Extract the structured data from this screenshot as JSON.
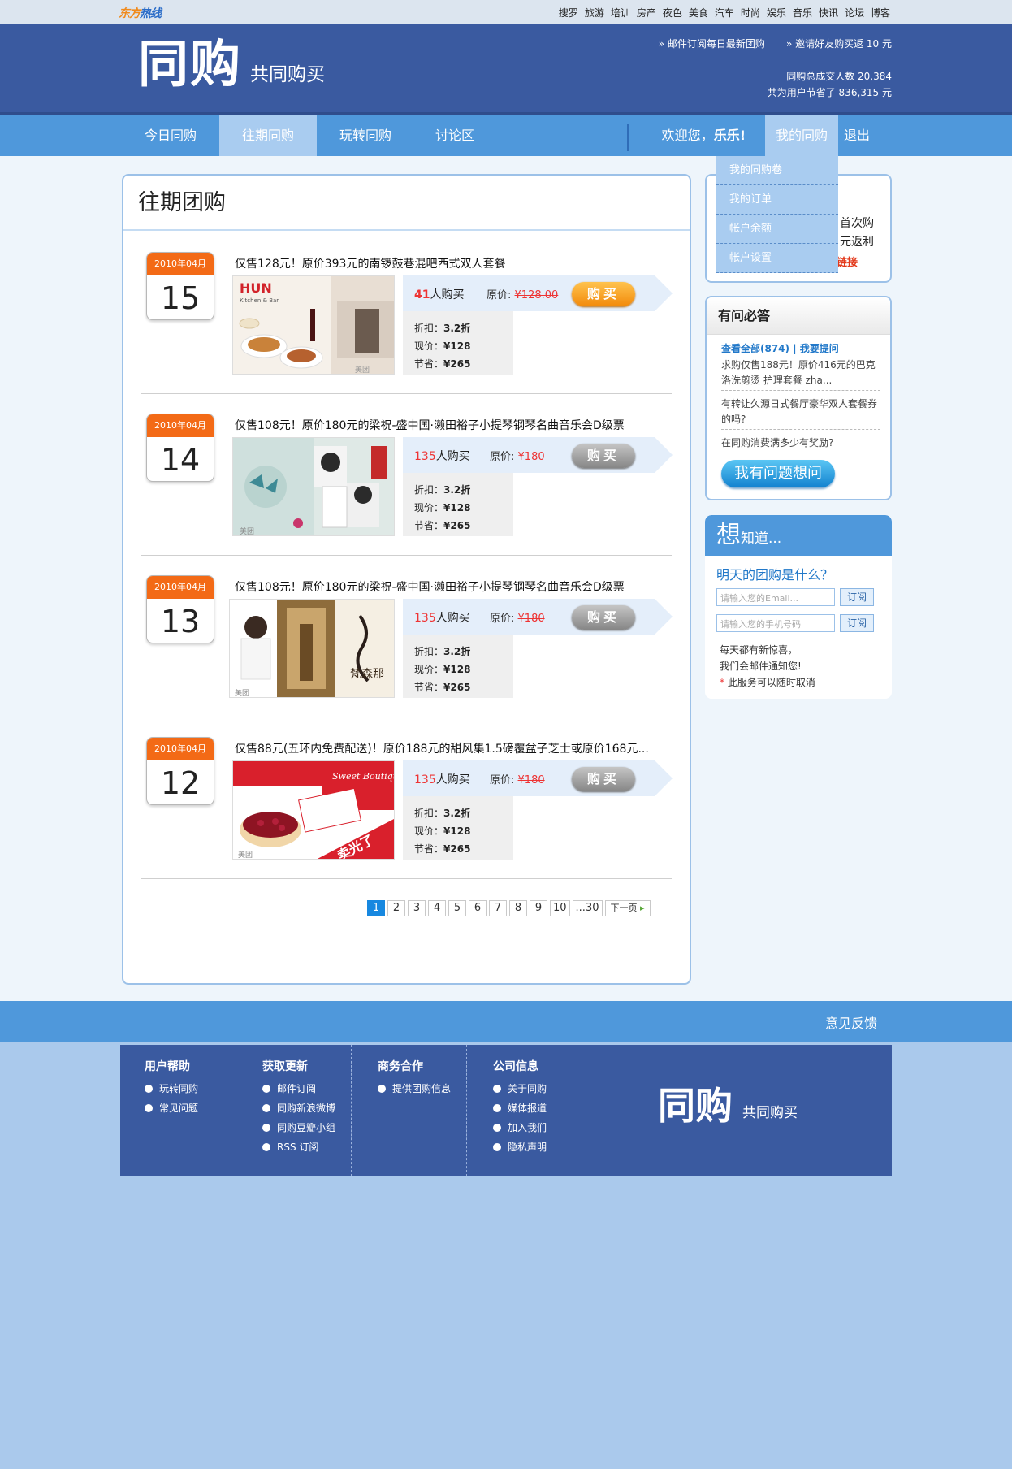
{
  "topbar": {
    "logo_a": "东方",
    "logo_b": "热线",
    "nav": [
      "搜罗",
      "旅游",
      "培训",
      "房产",
      "夜色",
      "美食",
      "汽车",
      "时尚",
      "娱乐",
      "音乐",
      "快讯",
      "论坛",
      "博客"
    ]
  },
  "header": {
    "brand_big": "同购",
    "brand_small": "共同购买",
    "link_subscribe": "» 邮件订阅每日最新团购",
    "link_invite": "» 邀请好友购买返 10 元",
    "stat_deals": "同购总成交人数 20,384",
    "stat_saved": "共为用户节省了 836,315 元"
  },
  "nav": {
    "today": "今日同购",
    "past": "往期同购",
    "play": "玩转同购",
    "forum": "讨论区",
    "welcome": "欢迎您，",
    "user": "乐乐!",
    "mine": "我的同购",
    "logout": "退出"
  },
  "dropdown": [
    "我的同购卷",
    "我的订单",
    "帐户余额",
    "帐户设置"
  ],
  "main": {
    "title": "往期团购",
    "buy_label": "购买",
    "buyers_suffix": "人购买",
    "orig_label": "原价:",
    "discount_label": "折扣：",
    "now_label": "现价：",
    "save_label": "节省：",
    "deals": [
      {
        "month": "2010年04月",
        "day": "15",
        "title": "仅售128元！原价393元的南锣鼓巷混吧西式双人套餐",
        "buyers": "41",
        "orig": "¥128.00",
        "discount": "3.2折",
        "price": "¥128",
        "save": "¥265",
        "button": "orange"
      },
      {
        "month": "2010年04月",
        "day": "14",
        "title": "仅售108元！原价180元的梁祝-盛中国·濑田裕子小提琴钢琴名曲音乐会D级票",
        "buyers": "135",
        "orig": "¥180",
        "discount": "3.2折",
        "price": "¥128",
        "save": "¥265",
        "button": "gray"
      },
      {
        "month": "2010年04月",
        "day": "13",
        "title": "仅售108元！原价180元的梁祝-盛中国·濑田裕子小提琴钢琴名曲音乐会D级票",
        "buyers": "135",
        "orig": "¥180",
        "discount": "3.2折",
        "price": "¥128",
        "save": "¥265",
        "button": "gray"
      },
      {
        "month": "2010年04月",
        "day": "12",
        "title": "仅售88元(五环内免费配送)！原价188元的甜风集1.5磅覆盆子芝士或原价168元...",
        "buyers": "135",
        "orig": "¥180",
        "discount": "3.2折",
        "price": "¥128",
        "save": "¥265",
        "button": "gray",
        "soldout": "卖光了"
      }
    ],
    "photo1_brand": "HUN",
    "photo1_sub": "Kitchen & Bar",
    "photo4_brand": "Sweet Boutique",
    "photo3_brand": "梵森那",
    "photo_watermark": "美团",
    "pager": [
      "1",
      "2",
      "3",
      "4",
      "5",
      "6",
      "7",
      "8",
      "9",
      "10",
      "...30"
    ],
    "pager_next": "下一页"
  },
  "side1": {
    "line1": "首次购",
    "line2": "元返利",
    "line3": "链接"
  },
  "faq": {
    "title": "有问必答",
    "links": "查看全部(874) | 我要提问",
    "q1": "求购仅售188元！原价416元的巴克洛洗剪烫 护理套餐 zha...",
    "q2": "有转让久源日式餐厅豪华双人套餐券的吗?",
    "q3": "在同购消费满多少有奖励?",
    "button": "我有问题想问"
  },
  "want": {
    "big": "想",
    "small": "知道...",
    "question": "明天的团购是什么？",
    "email_placeholder": "请输入您的Email...",
    "phone_placeholder": "请输入您的手机号码",
    "subscribe": "订阅",
    "note1": "每天都有新惊喜，",
    "note2": "我们会邮件通知您!",
    "note3": "此服务可以随时取消"
  },
  "footer": {
    "feedback": "意见反馈",
    "cols": [
      {
        "title": "用户帮助",
        "items": [
          "玩转同购",
          "常见问题"
        ]
      },
      {
        "title": "获取更新",
        "items": [
          "邮件订阅",
          "同购新浪微博",
          "同购豆瓣小组",
          "RSS 订阅"
        ]
      },
      {
        "title": "商务合作",
        "items": [
          "提供团购信息"
        ]
      },
      {
        "title": "公司信息",
        "items": [
          "关于同购",
          "媒体报道",
          "加入我们",
          "隐私声明"
        ]
      }
    ],
    "brand_big": "同购",
    "brand_small": "共同购买"
  }
}
